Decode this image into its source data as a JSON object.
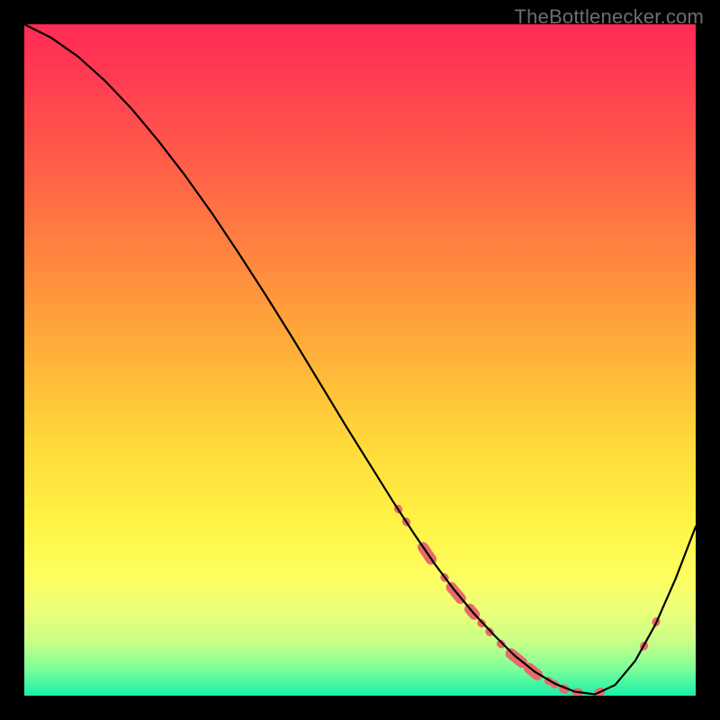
{
  "watermark": "TheBottlenecker.com",
  "chart_data": {
    "type": "line",
    "title": "",
    "xlabel": "",
    "ylabel": "",
    "xlim": [
      0,
      100
    ],
    "ylim": [
      0,
      100
    ],
    "series": [
      {
        "name": "curve",
        "x": [
          0,
          4,
          8,
          12,
          16,
          20,
          24,
          28,
          32,
          36,
          40,
          44,
          48,
          52,
          55,
          58,
          61,
          64,
          67,
          70,
          73,
          76,
          79,
          82,
          85,
          88,
          91,
          94,
          97,
          100
        ],
        "y": [
          100,
          98.0,
          95.2,
          91.6,
          87.4,
          82.6,
          77.4,
          71.8,
          65.8,
          59.6,
          53.2,
          46.6,
          40.0,
          33.6,
          28.8,
          24.2,
          19.8,
          15.8,
          12.2,
          9.0,
          6.0,
          3.6,
          1.8,
          0.6,
          0.2,
          1.6,
          5.2,
          10.6,
          17.4,
          25.2
        ]
      }
    ],
    "markers": [
      {
        "x": 55.7,
        "y": 27.8,
        "r": 5
      },
      {
        "x": 56.9,
        "y": 25.9,
        "r": 5
      },
      {
        "x": 60.0,
        "y": 21.2,
        "r": 14
      },
      {
        "x": 62.6,
        "y": 17.6,
        "r": 5
      },
      {
        "x": 64.3,
        "y": 15.3,
        "r": 14
      },
      {
        "x": 66.7,
        "y": 12.5,
        "r": 10
      },
      {
        "x": 68.1,
        "y": 10.8,
        "r": 5
      },
      {
        "x": 69.3,
        "y": 9.5,
        "r": 5
      },
      {
        "x": 71.0,
        "y": 7.7,
        "r": 5
      },
      {
        "x": 73.3,
        "y": 5.6,
        "r": 14
      },
      {
        "x": 75.8,
        "y": 3.6,
        "r": 12
      },
      {
        "x": 78.1,
        "y": 2.2,
        "r": 5
      },
      {
        "x": 79.0,
        "y": 1.7,
        "r": 5
      },
      {
        "x": 80.4,
        "y": 1.0,
        "r": 6
      },
      {
        "x": 82.4,
        "y": 0.45,
        "r": 6
      },
      {
        "x": 85.7,
        "y": 0.5,
        "r": 6
      },
      {
        "x": 92.3,
        "y": 7.4,
        "r": 5
      },
      {
        "x": 94.1,
        "y": 11.0,
        "r": 5
      }
    ],
    "curve_color": "#000000",
    "marker_color": "#e86a6a",
    "gradient_top": "#ff2b54",
    "gradient_bottom": "#18f0a8"
  }
}
